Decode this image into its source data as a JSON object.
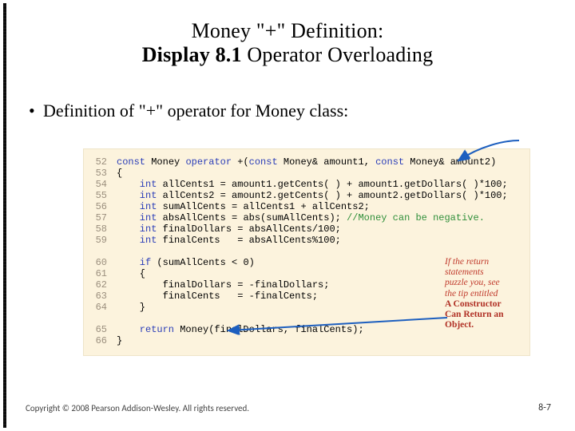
{
  "title": {
    "line1": "Money \"+\" Definition:",
    "line2a": "Display 8.1",
    "line2b": "  Operator Overloading"
  },
  "bullet": "Definition of \"+\" operator for Money class:",
  "lines": {
    "ln52": "52",
    "ln53": "53",
    "ln54": "54",
    "ln55": "55",
    "ln56": "56",
    "ln57": "57",
    "ln58": "58",
    "ln59": "59",
    "ln60": "60",
    "ln61": "61",
    "ln62": "62",
    "ln63": "63",
    "ln64": "64",
    "ln65": "65",
    "ln66": "66"
  },
  "code": {
    "c52a": "const",
    "c52b": " Money ",
    "c52c": "operator",
    "c52d": " +(",
    "c52e": "const",
    "c52f": " Money& amount1, ",
    "c52g": "const",
    "c52h": " Money& amount2)",
    "c53": "{",
    "c54a": "    int",
    "c54b": " allCents1 = amount1.getCents( ) + amount1.getDollars( )*100;",
    "c55a": "    int",
    "c55b": " allCents2 = amount2.getCents( ) + amount2.getDollars( )*100;",
    "c56a": "    int",
    "c56b": " sumAllCents = allCents1 + allCents2;",
    "c57a": "    int",
    "c57b": " absAllCents = abs(sumAllCents); ",
    "c57c": "//Money can be negative.",
    "c58a": "    int",
    "c58b": " finalDollars = absAllCents/100;",
    "c59a": "    int",
    "c59b": " finalCents   = absAllCents%100;",
    "c60a": "    if",
    "c60b": " (sumAllCents < 0)",
    "c61": "    {",
    "c62": "        finalDollars = -finalDollars;",
    "c63": "        finalCents   = -finalCents;",
    "c64": "    }",
    "c65a": "    return",
    "c65b": " Money(finalDollars, finalCents);",
    "c66": "}"
  },
  "annotation": {
    "l1": "If the return",
    "l2": "statements",
    "l3": "puzzle you, see",
    "l4": "the tip entitled",
    "l5": "A Constructor",
    "l6": "Can Return an",
    "l7": "Object."
  },
  "footer": "Copyright © 2008 Pearson Addison-Wesley. All rights reserved.",
  "pagenum": "8-7"
}
